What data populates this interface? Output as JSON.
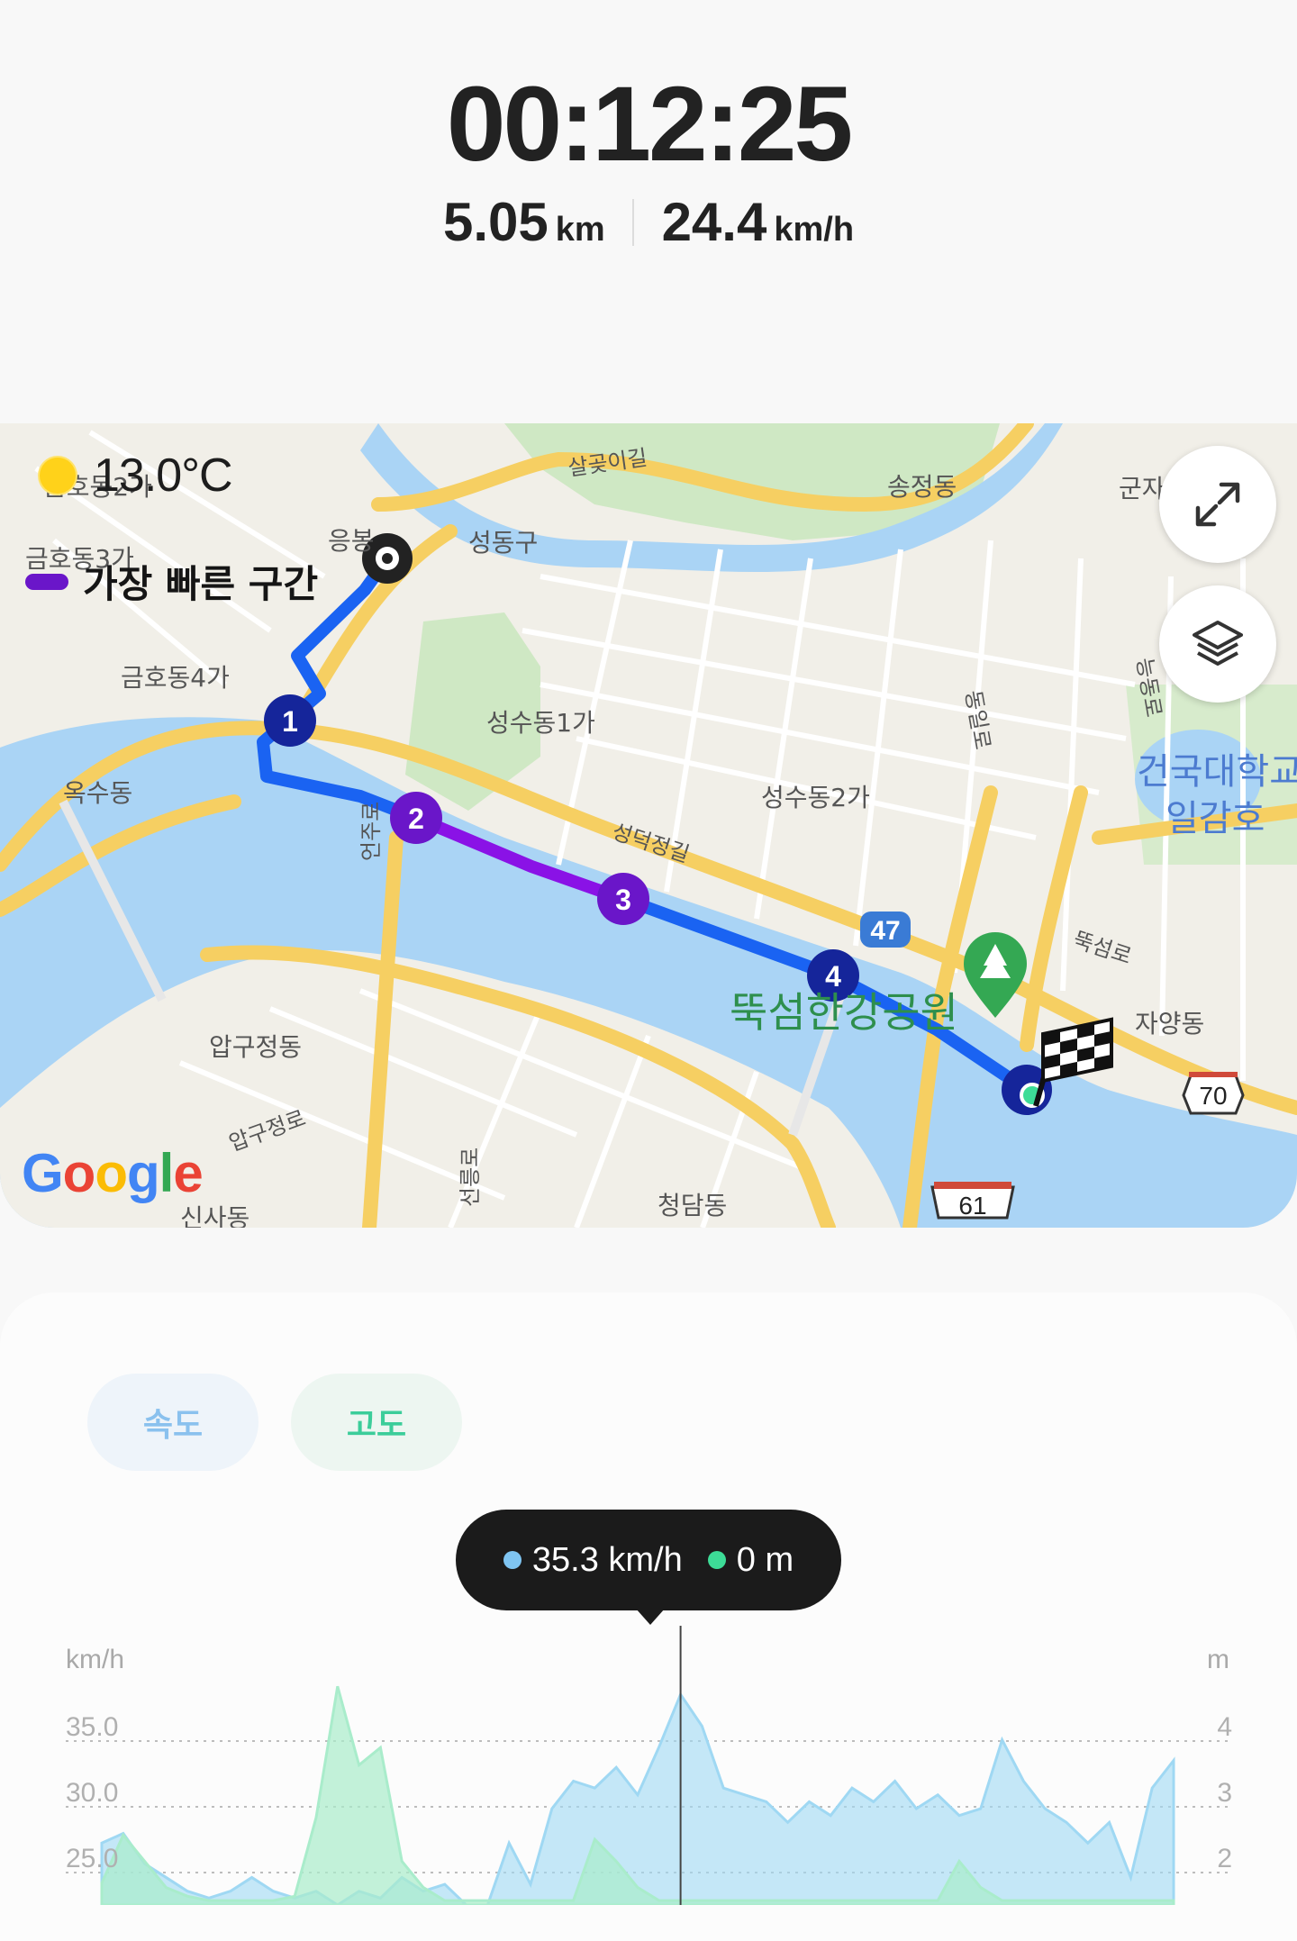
{
  "summary": {
    "elapsed_time": "00:12:25",
    "distance_value": "5.05",
    "distance_unit": "km",
    "avg_speed_value": "24.4",
    "avg_speed_unit": "km/h"
  },
  "map": {
    "temperature": "13.0°C",
    "weather_icon": "sun-icon",
    "legend_label": "가장 빠른 구간",
    "legend_color": "#6a16c9",
    "route_color": "#1a63f2",
    "fastest_color": "#8a12e6",
    "attribution": "Google",
    "split_markers": [
      "1",
      "2",
      "3",
      "4"
    ],
    "labels": {
      "geumho2": "금호동2가",
      "geumho3": "금호동3가",
      "geumho4": "금호동4가",
      "oksu": "옥수동",
      "eungbong": "응봉",
      "salgoji": "살곶이길",
      "seongdong": "성동구",
      "songjeong": "송정동",
      "gunja": "군자",
      "seongsu1": "성수동1가",
      "seongsu2": "성수동2가",
      "seongdeok": "성덕정길",
      "dongil": "동일로",
      "konkuk": "건국대학교",
      "ilgamho": "일감호",
      "ttukseom_ro": "뚝섬로",
      "jayang": "자양동",
      "ttukseom_park": "뚝섬한강공원",
      "apgujeong": "압구정동",
      "apgujeong_ro": "압구정로",
      "cheongdam": "청담동",
      "sinsa": "신사동",
      "eonju": "언주로",
      "seolleung": "선릉로",
      "neungdong": "능동로",
      "route47": "47",
      "route61": "61",
      "route70": "70"
    }
  },
  "tabs": {
    "speed": "속도",
    "altitude": "고도"
  },
  "tooltip": {
    "speed": "35.3 km/h",
    "altitude": "0 m",
    "speed_color": "#7fc5f2",
    "altitude_color": "#3ddc97"
  },
  "chart_data": {
    "type": "area",
    "left_axis_unit": "km/h",
    "right_axis_unit": "m",
    "left_ticks": [
      "35.0",
      "30.0",
      "25.0"
    ],
    "right_ticks": [
      "4",
      "3",
      "2"
    ],
    "series": [
      {
        "name": "속도",
        "color": "#9fd8f3",
        "x": [
          0.0,
          0.02,
          0.04,
          0.06,
          0.08,
          0.1,
          0.12,
          0.14,
          0.16,
          0.18,
          0.2,
          0.22,
          0.24,
          0.26,
          0.28,
          0.3,
          0.32,
          0.34,
          0.36,
          0.38,
          0.4,
          0.42,
          0.44,
          0.46,
          0.48,
          0.5,
          0.52,
          0.54,
          0.56,
          0.58,
          0.6,
          0.62,
          0.64,
          0.66,
          0.68,
          0.7,
          0.72,
          0.74,
          0.76,
          0.78,
          0.8,
          0.82,
          0.84,
          0.86,
          0.88,
          0.9,
          0.92,
          0.94,
          0.96,
          0.98,
          1.0
        ],
        "y": [
          24.5,
          25.2,
          23.0,
          22.0,
          21.0,
          20.5,
          21.0,
          22.0,
          21.0,
          20.5,
          21.0,
          20.0,
          21.0,
          20.5,
          22.0,
          21.0,
          21.5,
          20.0,
          19.0,
          24.5,
          21.5,
          27.0,
          29.0,
          28.5,
          30.0,
          28.0,
          31.5,
          35.3,
          33.0,
          28.5,
          28.0,
          27.5,
          26.0,
          27.5,
          26.5,
          28.5,
          27.5,
          29.0,
          27.0,
          28.0,
          26.5,
          27.0,
          32.0,
          29.0,
          27.0,
          26.0,
          24.5,
          26.0,
          22.0,
          28.5,
          30.5
        ],
        "xlim": [
          0,
          1
        ],
        "ylim": [
          20,
          38
        ]
      },
      {
        "name": "고도",
        "color": "#a9eccb",
        "x": [
          0.0,
          0.02,
          0.04,
          0.06,
          0.08,
          0.1,
          0.12,
          0.14,
          0.16,
          0.18,
          0.2,
          0.22,
          0.24,
          0.26,
          0.28,
          0.3,
          0.32,
          0.34,
          0.36,
          0.38,
          0.4,
          0.42,
          0.44,
          0.46,
          0.48,
          0.5,
          0.52,
          0.54,
          0.56,
          0.58,
          0.6,
          0.62,
          0.64,
          0.66,
          0.68,
          0.7,
          0.72,
          0.74,
          0.76,
          0.78,
          0.8,
          0.82,
          0.84,
          0.86,
          0.88,
          0.9,
          0.92,
          0.94,
          0.96,
          0.98,
          1.0
        ],
        "y": [
          0.5,
          1.6,
          1.0,
          0.4,
          0.2,
          0.1,
          0.1,
          0.1,
          0.1,
          0.2,
          2.0,
          5.0,
          3.2,
          3.6,
          1.0,
          0.4,
          0.1,
          0.1,
          0.1,
          0.1,
          0.1,
          0.1,
          0.1,
          1.5,
          1.0,
          0.4,
          0.1,
          0.1,
          0.1,
          0.1,
          0.1,
          0.1,
          0.1,
          0.1,
          0.1,
          0.1,
          0.1,
          0.1,
          0.1,
          0.1,
          1.0,
          0.4,
          0.1,
          0.1,
          0.1,
          0.1,
          0.1,
          0.1,
          0.1,
          0.1,
          0.1
        ],
        "xlim": [
          0,
          1
        ],
        "ylim": [
          0,
          5.5
        ]
      }
    ],
    "cursor_x": 0.54,
    "grid": "dotted"
  }
}
